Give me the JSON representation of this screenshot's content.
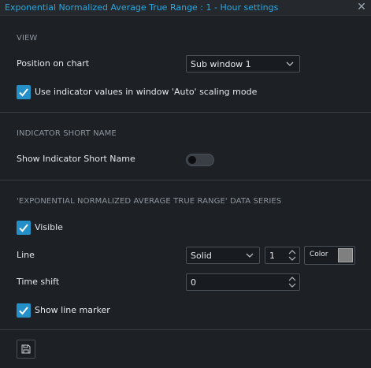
{
  "dialog": {
    "title": "Exponential Normalized Average True Range : 1 - Hour settings",
    "close_icon": "close-icon"
  },
  "view": {
    "section_title": "VIEW",
    "position_label": "Position on chart",
    "position_value": "Sub window 1",
    "auto_scaling_label": "Use indicator values in window 'Auto' scaling mode",
    "auto_scaling_checked": true
  },
  "short_name": {
    "section_title": "INDICATOR SHORT NAME",
    "show_label": "Show Indicator Short Name",
    "show_enabled": false
  },
  "series": {
    "section_title": "'EXPONENTIAL NORMALIZED AVERAGE TRUE RANGE' DATA SERIES",
    "visible_label": "Visible",
    "visible_checked": true,
    "line_label": "Line",
    "line_style": "Solid",
    "line_width": "1",
    "color_label": "Color",
    "color_value": "#7f7f7f",
    "time_shift_label": "Time shift",
    "time_shift_value": "0",
    "marker_label": "Show line marker",
    "marker_checked": true
  },
  "footer": {
    "save_icon": "save-icon"
  },
  "colors": {
    "accent": "#28a8e0",
    "checkbox": "#2490c7",
    "background": "#1d2024"
  }
}
